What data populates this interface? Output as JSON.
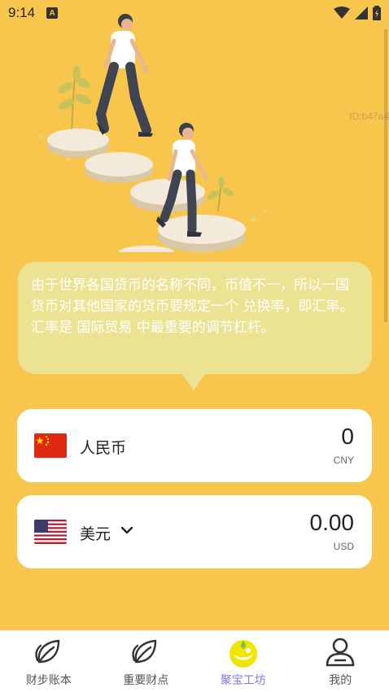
{
  "status": {
    "time": "9:14",
    "notification": "A"
  },
  "watermark": "ID:b47a4",
  "info_text": "由于世界各国货币的名称不同，币值不一，所以一国货币对其他国家的货币要规定一个 兑换率，即汇率。 汇率是 国际贸易 中最重要的调节杠杆。",
  "currencies": [
    {
      "name": "人民币",
      "amount": "0",
      "code": "CNY",
      "flag": "china-flag"
    },
    {
      "name": "美元",
      "amount": "0.00",
      "code": "USD",
      "flag": "usa-flag",
      "dropdown": true
    }
  ],
  "tabs": [
    {
      "label": "财步账本",
      "icon": "leaf-icon",
      "active": false
    },
    {
      "label": "重要财点",
      "icon": "leaf-icon",
      "active": false
    },
    {
      "label": "聚宝工坊",
      "icon": "gold-ingot-icon",
      "active": true
    },
    {
      "label": "我的",
      "icon": "user-icon",
      "active": false
    }
  ],
  "colors": {
    "background": "#F8C54D",
    "bubble": "#ECE392",
    "active_tab": "#7C7AE0"
  }
}
